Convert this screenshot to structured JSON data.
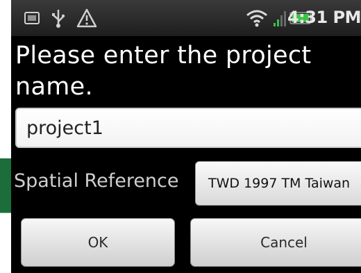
{
  "status_bar": {
    "icons": [
      "sim-card-icon",
      "usb-icon",
      "warning-icon",
      "wifi-icon",
      "signal-icon",
      "battery-icon"
    ],
    "time": "4:31 PM"
  },
  "dialog": {
    "prompt": "Please enter the project name.",
    "name_value": "project1",
    "spatial_label": "Spatial Reference",
    "spatial_value": "TWD 1997 TM Taiwan",
    "ok_label": "OK",
    "cancel_label": "Cancel"
  },
  "colors": {
    "background": "#000000",
    "battery": "#3cc24a",
    "signal": "#37c24a"
  }
}
